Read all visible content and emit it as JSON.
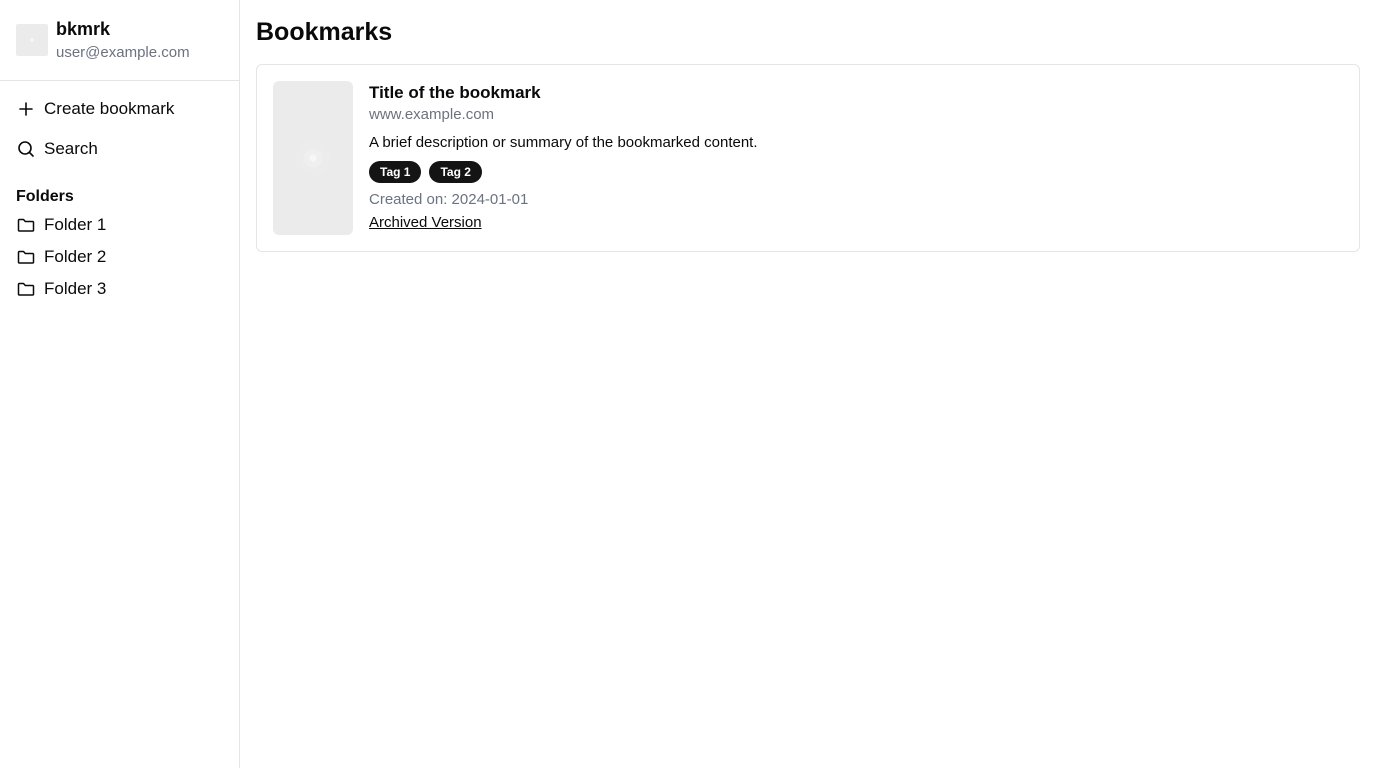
{
  "sidebar": {
    "app_name": "bkmrk",
    "user_email": "user@example.com",
    "nav": [
      {
        "label": "Create bookmark",
        "icon": "plus-icon"
      },
      {
        "label": "Search",
        "icon": "search-icon"
      }
    ],
    "folders_heading": "Folders",
    "folders": [
      {
        "label": "Folder 1",
        "icon": "folder-icon"
      },
      {
        "label": "Folder 2",
        "icon": "folder-icon"
      },
      {
        "label": "Folder 3",
        "icon": "folder-icon"
      }
    ]
  },
  "main": {
    "title": "Bookmarks",
    "bookmarks": [
      {
        "title": "Title of the bookmark",
        "url": "www.example.com",
        "description": "A brief description or summary of the bookmarked content.",
        "tags": [
          "Tag 1",
          "Tag 2"
        ],
        "created": "Created on: 2024-01-01",
        "archive_link": "Archived Version"
      }
    ]
  },
  "colors": {
    "text": "#0a0a0a",
    "muted": "#6b7280",
    "border": "#e5e5e5",
    "tag_bg": "#141414",
    "placeholder": "#ebebeb"
  }
}
